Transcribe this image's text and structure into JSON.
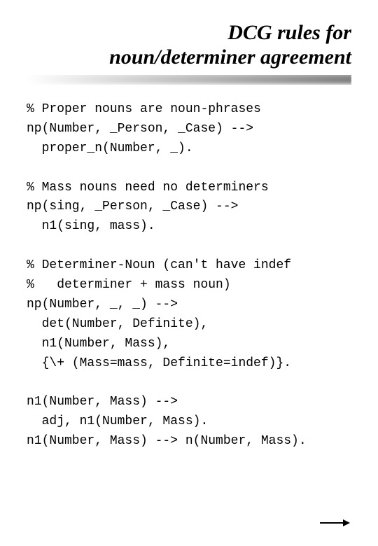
{
  "title_line1": "DCG rules for",
  "title_line2": "noun/determiner agreement",
  "code": "% Proper nouns are noun-phrases\nnp(Number, _Person, _Case) -->\n  proper_n(Number, _).\n\n% Mass nouns need no determiners\nnp(sing, _Person, _Case) -->\n  n1(sing, mass).\n\n% Determiner-Noun (can't have indef\n%   determiner + mass noun)\nnp(Number, _, _) -->\n  det(Number, Definite),\n  n1(Number, Mass),\n  {\\+ (Mass=mass, Definite=indef)}.\n\nn1(Number, Mass) -->\n  adj, n1(Number, Mass).\nn1(Number, Mass) --> n(Number, Mass)."
}
